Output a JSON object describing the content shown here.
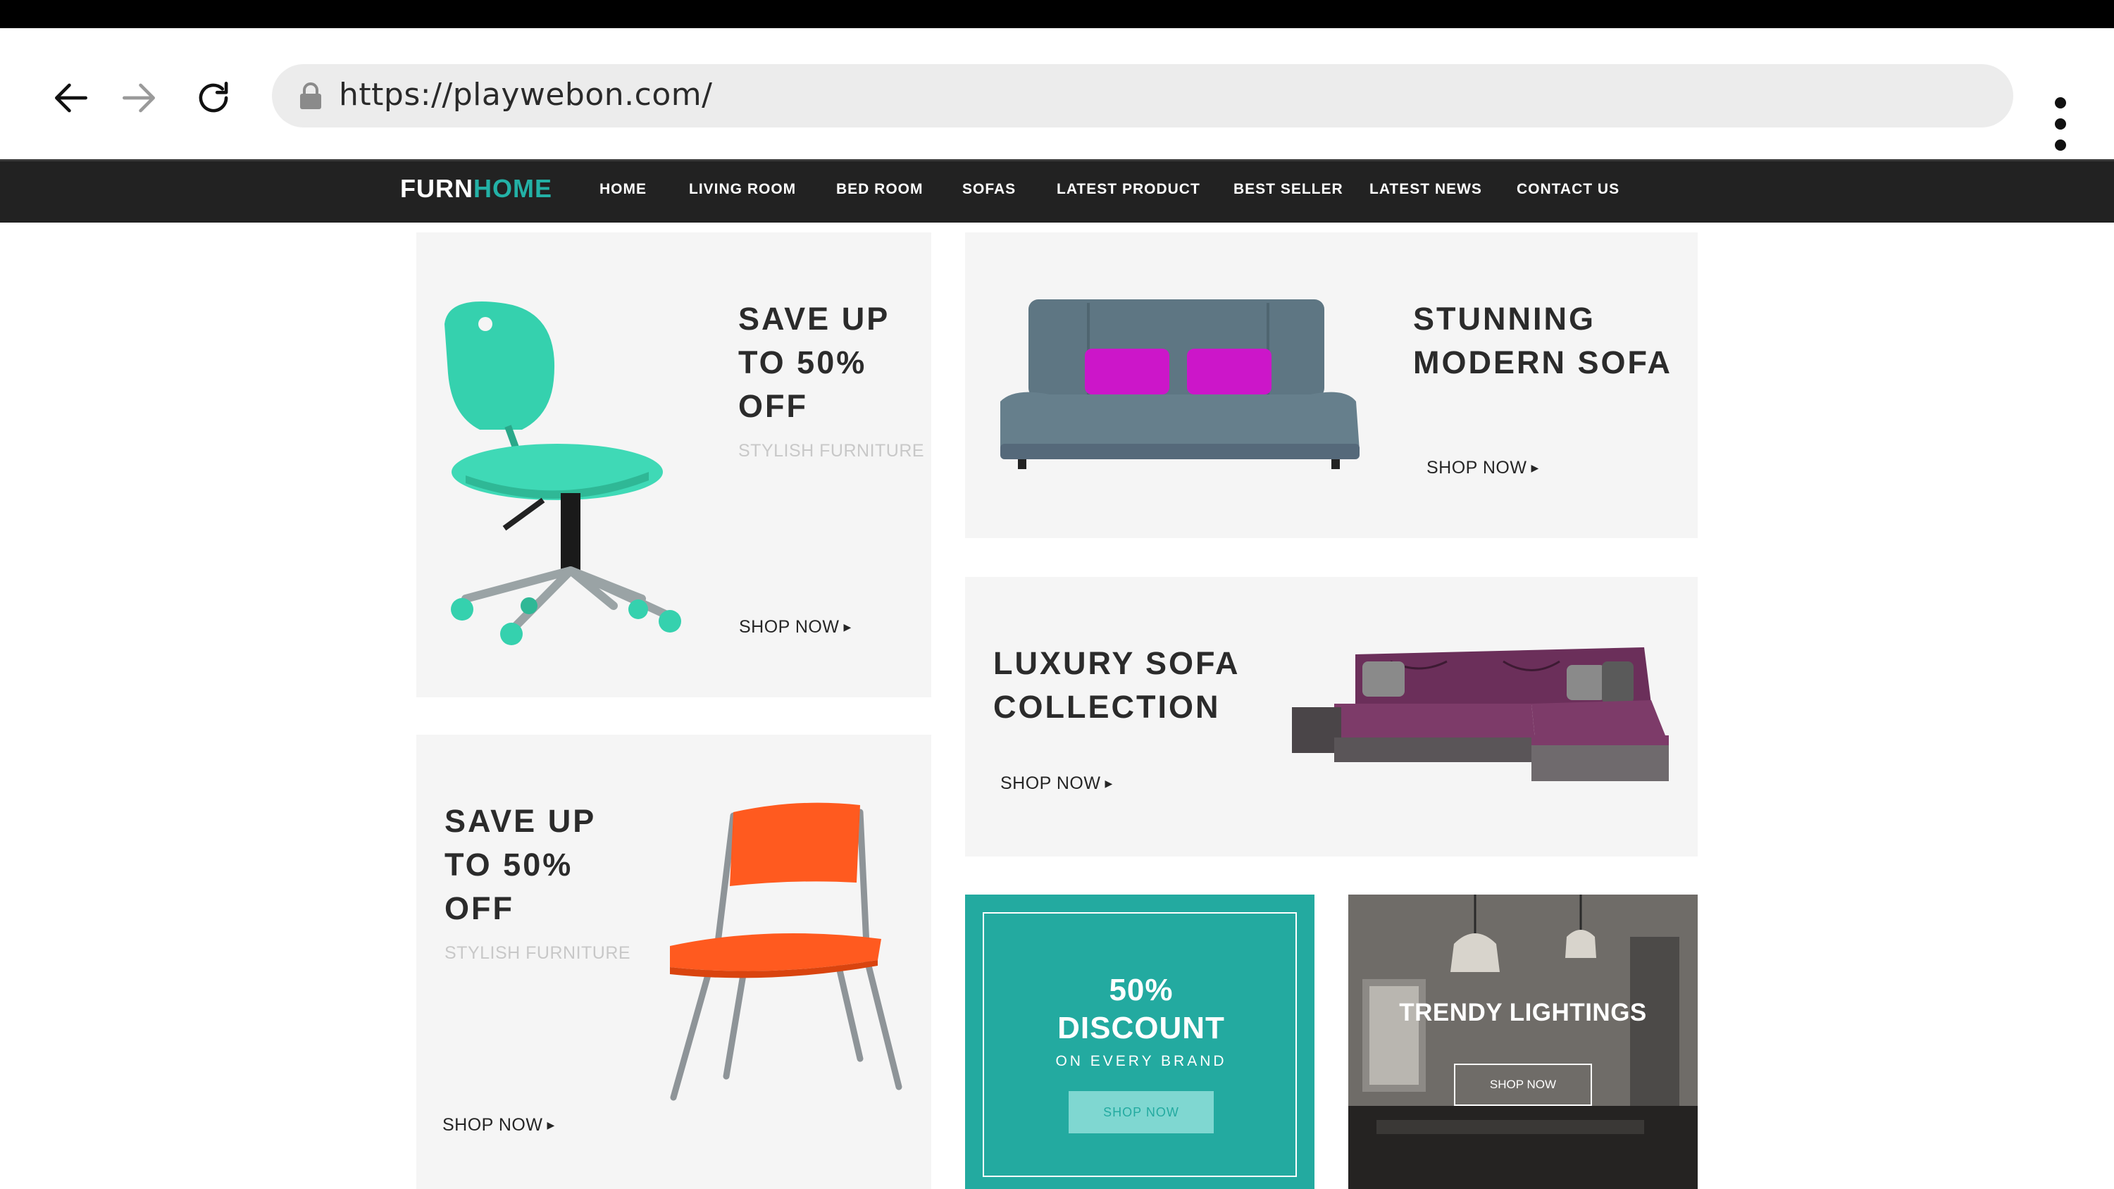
{
  "browser": {
    "url": "https://playwebon.com/",
    "icons": {
      "back": "arrow-left-icon",
      "forward": "arrow-right-icon",
      "reload": "reload-icon",
      "lock": "lock-icon",
      "menu": "more-vertical-icon"
    }
  },
  "site": {
    "logo_part1": "FURN",
    "logo_part2": "HOME",
    "accent_color": "#23b1a6",
    "nav": [
      "HOME",
      "LIVING ROOM",
      "BED ROOM",
      "SOFAS",
      "LATEST PRODUCT",
      "BEST SELLER",
      "LATEST NEWS",
      "CONTACT US"
    ]
  },
  "banners": {
    "teal_chair": {
      "title": "SAVE UP\nTO 50%\nOFF",
      "subtitle": "STYLISH FURNITURE",
      "cta": "SHOP NOW"
    },
    "modern_sofa": {
      "title": "STUNNING\nMODERN SOFA",
      "cta": "SHOP NOW"
    },
    "luxury_sofa": {
      "title": "LUXURY SOFA\nCOLLECTION",
      "cta": "SHOP NOW"
    },
    "orange_chair": {
      "title": "SAVE UP\nTO 50%\nOFF",
      "subtitle": "STYLISH FURNITURE",
      "cta": "SHOP NOW"
    },
    "discount": {
      "title": "50%\nDISCOUNT",
      "subtitle": "ON EVERY BRAND",
      "cta": "SHOP NOW",
      "color": "#23aaa0"
    },
    "lightings": {
      "title": "TRENDY LIGHTINGS",
      "cta": "SHOP NOW"
    }
  }
}
